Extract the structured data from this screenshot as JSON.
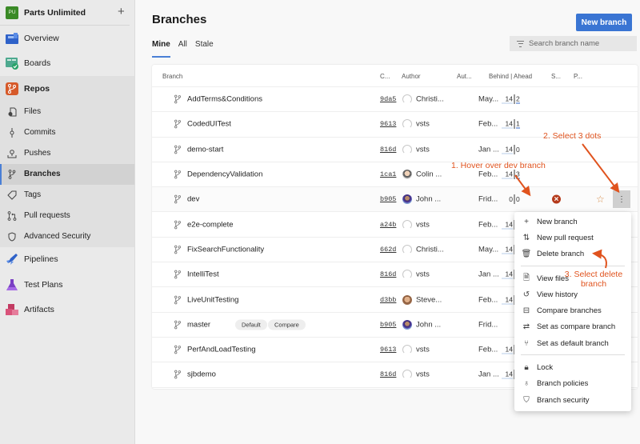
{
  "sidebar": {
    "org": {
      "badge": "PU",
      "name": "Parts Unlimited",
      "add_label": "+"
    },
    "items": [
      {
        "label": "Overview",
        "icon": "overview-icon"
      },
      {
        "label": "Boards",
        "icon": "boards-icon"
      },
      {
        "label": "Repos",
        "icon": "repos-icon"
      }
    ],
    "repos_sub": [
      {
        "label": "Files",
        "icon": "files-icon"
      },
      {
        "label": "Commits",
        "icon": "commits-icon"
      },
      {
        "label": "Pushes",
        "icon": "pushes-icon"
      },
      {
        "label": "Branches",
        "icon": "branch-icon",
        "active": true
      },
      {
        "label": "Tags",
        "icon": "tag-icon"
      },
      {
        "label": "Pull requests",
        "icon": "pull-request-icon"
      },
      {
        "label": "Advanced Security",
        "icon": "shield-icon"
      }
    ],
    "bottom_items": [
      {
        "label": "Pipelines",
        "icon": "pipelines-icon"
      },
      {
        "label": "Test Plans",
        "icon": "test-plans-icon"
      },
      {
        "label": "Artifacts",
        "icon": "artifacts-icon"
      }
    ]
  },
  "header": {
    "title": "Branches",
    "new_branch_label": "New branch",
    "tabs": [
      "Mine",
      "All",
      "Stale"
    ],
    "active_tab": "Mine",
    "search_placeholder": "Search branch name"
  },
  "table": {
    "columns": [
      "Branch",
      "C...",
      "Author",
      "Aut...",
      "Behind | Ahead",
      "S...",
      "P..."
    ],
    "rows": [
      {
        "branch": "AddTerms&Conditions",
        "commit": "9da5",
        "author": "Christi...",
        "avatar": "default",
        "date": "May...",
        "behind": "14",
        "ahead": "2"
      },
      {
        "branch": "CodedUITest",
        "commit": "9613",
        "author": "vsts",
        "avatar": "default",
        "date": "Feb...",
        "behind": "14",
        "ahead": "1"
      },
      {
        "branch": "demo-start",
        "commit": "816d",
        "author": "vsts",
        "avatar": "default",
        "date": "Jan ...",
        "behind": "14",
        "ahead": "0"
      },
      {
        "branch": "DependencyValidation",
        "commit": "1ca1",
        "author": "Colin ...",
        "avatar": "colin",
        "date": "Feb...",
        "behind": "14",
        "ahead": "3"
      },
      {
        "branch": "dev",
        "commit": "b905",
        "author": "John ...",
        "avatar": "john",
        "date": "Frid...",
        "behind": "0",
        "ahead": "0",
        "hovered": true
      },
      {
        "branch": "e2e-complete",
        "commit": "a24b",
        "author": "vsts",
        "avatar": "default",
        "date": "Feb...",
        "behind": "14",
        "ahead": ""
      },
      {
        "branch": "FixSearchFunctionality",
        "commit": "662d",
        "author": "Christi...",
        "avatar": "default",
        "date": "May...",
        "behind": "14",
        "ahead": ""
      },
      {
        "branch": "IntelliTest",
        "commit": "816d",
        "author": "vsts",
        "avatar": "default",
        "date": "Jan ...",
        "behind": "14",
        "ahead": ""
      },
      {
        "branch": "LiveUnitTesting",
        "commit": "d3bb",
        "author": "Steve...",
        "avatar": "steve",
        "date": "Feb...",
        "behind": "14",
        "ahead": ""
      },
      {
        "branch": "master",
        "commit": "b905",
        "author": "John ...",
        "avatar": "john",
        "date": "Frid...",
        "behind": "",
        "ahead": "",
        "badges": [
          "Default",
          "Compare"
        ]
      },
      {
        "branch": "PerfAndLoadTesting",
        "commit": "9613",
        "author": "vsts",
        "avatar": "default",
        "date": "Feb...",
        "behind": "14",
        "ahead": ""
      },
      {
        "branch": "sjbdemo",
        "commit": "816d",
        "author": "vsts",
        "avatar": "default",
        "date": "Jan ...",
        "behind": "14",
        "ahead": ""
      }
    ]
  },
  "context_menu": {
    "groups": [
      [
        {
          "label": "New branch",
          "icon": "plus-icon"
        },
        {
          "label": "New pull request",
          "icon": "pull-request-icon"
        },
        {
          "label": "Delete branch",
          "icon": "trash-icon"
        }
      ],
      [
        {
          "label": "View files",
          "icon": "files-icon"
        },
        {
          "label": "View history",
          "icon": "history-icon"
        },
        {
          "label": "Compare branches",
          "icon": "compare-icon"
        },
        {
          "label": "Set as compare branch",
          "icon": "compare-branch-icon"
        },
        {
          "label": "Set as default branch",
          "icon": "branch-icon"
        }
      ],
      [
        {
          "label": "Lock",
          "icon": "lock-icon"
        },
        {
          "label": "Branch policies",
          "icon": "policy-icon"
        },
        {
          "label": "Branch security",
          "icon": "shield-icon"
        }
      ]
    ]
  },
  "annotations": {
    "step1": "1. Hover over dev branch",
    "step2": "2. Select 3 dots",
    "step3_line1": "3. Select delete",
    "step3_line2": "branch"
  },
  "colors": {
    "accent": "#3a75d3",
    "annotation": "#e0531e",
    "delete": "#b53b1c",
    "org_badge": "#3a8a26"
  }
}
